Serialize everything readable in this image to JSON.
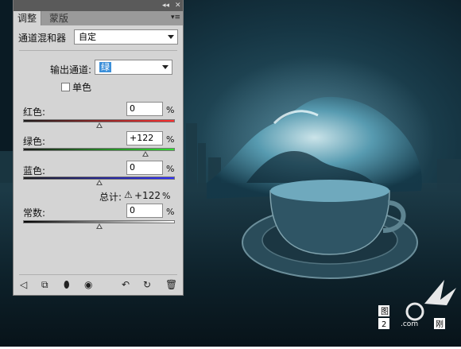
{
  "panel": {
    "tabs": [
      {
        "label": "调整"
      },
      {
        "label": "蒙版"
      }
    ],
    "mixer_label": "通道混和器",
    "preset_value": "自定",
    "output_label": "输出通道:",
    "output_value": "绿",
    "mono_label": "单色",
    "sliders": [
      {
        "label": "红色:",
        "value": "0",
        "unit": "%",
        "level": 0.5,
        "gradient": [
          "#1a1a1a",
          "#ff3030"
        ]
      },
      {
        "label": "绿色:",
        "value": "+122",
        "unit": "%",
        "level": 0.805,
        "gradient": [
          "#1a1a1a",
          "#30e030"
        ]
      },
      {
        "label": "蓝色:",
        "value": "0",
        "unit": "%",
        "level": 0.5,
        "gradient": [
          "#1a1a1a",
          "#3030ff"
        ]
      }
    ],
    "total_label": "总计:",
    "total_value": "+122",
    "total_unit": "%",
    "constant": {
      "label": "常数:",
      "value": "0",
      "unit": "%",
      "level": 0.5,
      "gradient": [
        "#000000",
        "#ffffff"
      ]
    },
    "bottom_icons": [
      "back-arrow-icon",
      "expand-view-icon",
      "clip-layer-icon",
      "eye-visibility-icon",
      "reset-icon",
      "refresh-icon",
      "trash-icon"
    ]
  },
  "watermark": {
    "line1": "图",
    "line2": "2",
    "site": ".com",
    "tail": "刚"
  }
}
